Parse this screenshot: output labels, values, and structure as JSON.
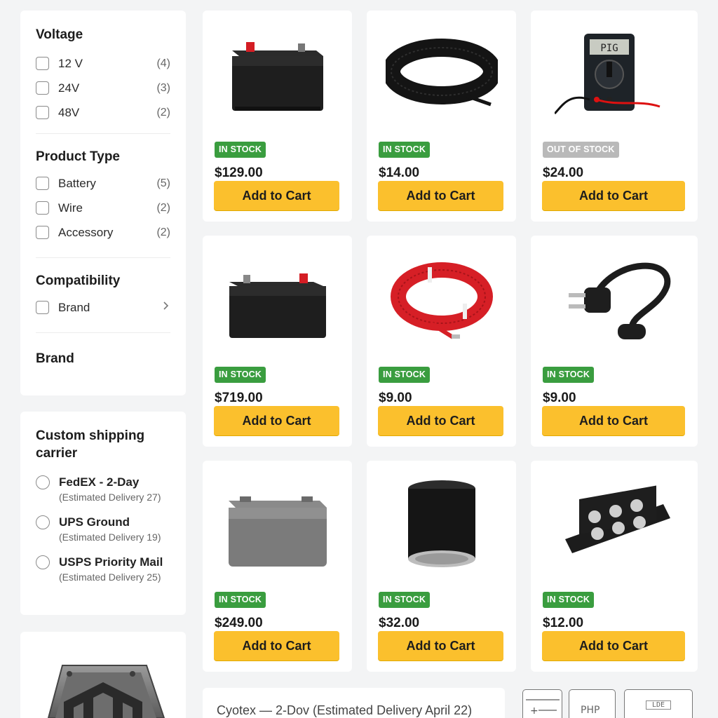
{
  "filters": {
    "voltage": {
      "title": "Voltage",
      "options": [
        {
          "label": "12 V",
          "count": "(4)"
        },
        {
          "label": "24V",
          "count": "(3)"
        },
        {
          "label": "48V",
          "count": "(2)"
        }
      ]
    },
    "product_type": {
      "title": "Product Type",
      "options": [
        {
          "label": "Battery",
          "count": "(5)"
        },
        {
          "label": "Wire",
          "count": "(2)"
        },
        {
          "label": "Accessory",
          "count": "(2)"
        }
      ]
    },
    "compatibility": {
      "title": "Compatibility",
      "options": [
        {
          "label": "Brand",
          "icon": "chevron-right-icon"
        }
      ]
    },
    "brand": {
      "title": "Brand"
    }
  },
  "shipping": {
    "title": "Custom shipping carrier",
    "options": [
      {
        "name": "FedEX - 2-Day",
        "estimate": "(Estimated Delivery 27)"
      },
      {
        "name": "UPS Ground",
        "estimate": "(Estimated Delivery 19)"
      },
      {
        "name": "USPS Priority Mail",
        "estimate": "(Estimated Delivery 25)"
      }
    ]
  },
  "logo": {
    "icon": "magento-logo-icon"
  },
  "products": [
    {
      "icon": "battery-icon",
      "stock": "IN STOCK",
      "price": "$129.00",
      "cta": "Add to Cart"
    },
    {
      "icon": "wire-coil-icon",
      "stock": "IN STOCK",
      "price": "$14.00",
      "cta": "Add to Cart"
    },
    {
      "icon": "multimeter-icon",
      "stock": "OUT OF STOCK",
      "price": "$24.00",
      "cta": "Add to Cart"
    },
    {
      "icon": "battery-icon",
      "stock": "IN STOCK",
      "price": "$719.00",
      "cta": "Add to Cart"
    },
    {
      "icon": "red-wire-coil-icon",
      "stock": "IN STOCK",
      "price": "$9.00",
      "cta": "Add to Cart"
    },
    {
      "icon": "power-plug-icon",
      "stock": "IN STOCK",
      "price": "$9.00",
      "cta": "Add to Cart"
    },
    {
      "icon": "gray-battery-icon",
      "stock": "IN STOCK",
      "price": "$249.00",
      "cta": "Add to Cart"
    },
    {
      "icon": "oil-filter-icon",
      "stock": "IN STOCK",
      "price": "$32.00",
      "cta": "Add to Cart"
    },
    {
      "icon": "terminal-block-icon",
      "stock": "IN STOCK",
      "price": "$12.00",
      "cta": "Add to Cart"
    }
  ],
  "bottom_bar": {
    "text": "Cyotex — 2-Dov (Estimated Delivery   April 22)"
  },
  "widgets": {
    "php_label": "PHP",
    "ldb_label": "LDE"
  },
  "colors": {
    "accent_button": "#fbc02d",
    "in_stock": "#3a9d3f",
    "out_of_stock": "#b9b9b9",
    "background": "#f3f4f5"
  }
}
